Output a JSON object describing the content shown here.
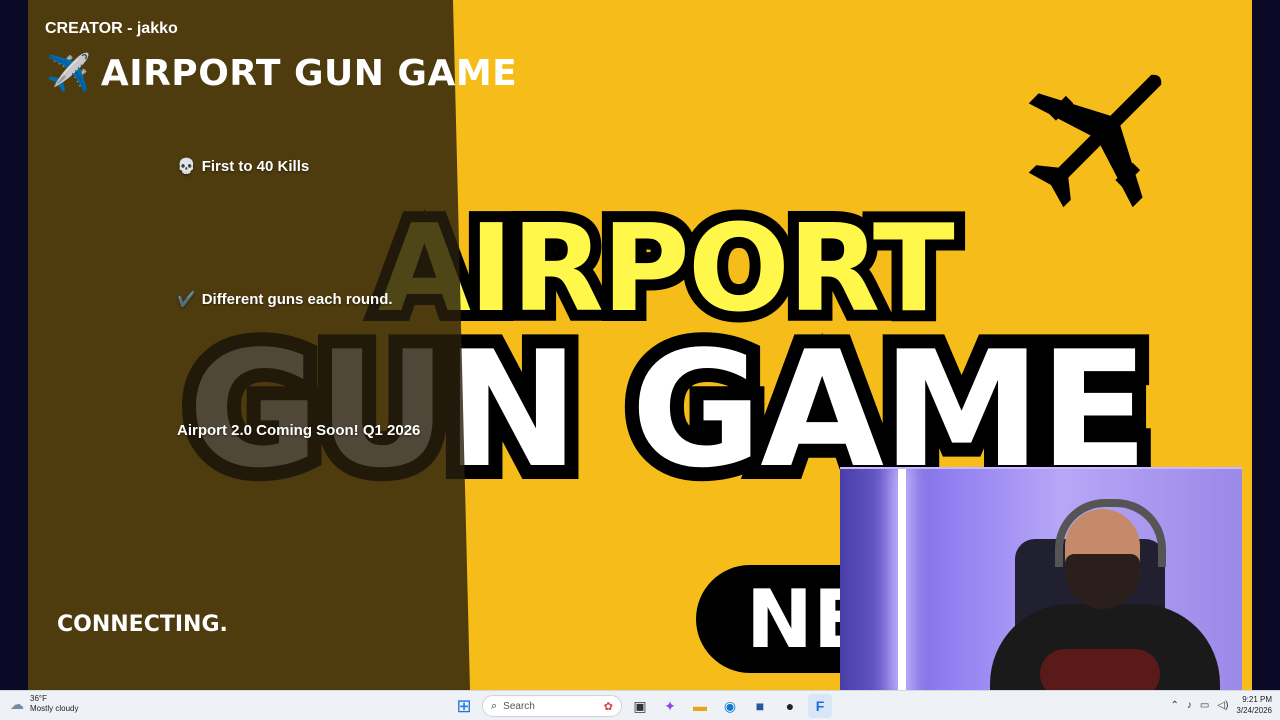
{
  "game": {
    "creator": "CREATOR - jakko",
    "title_emoji": "✈️",
    "title": "AIRPORT GUN GAME",
    "info": [
      {
        "icon": "💀",
        "text": "First to 40 Kills"
      },
      {
        "icon": "✔️",
        "text": "Different guns each round."
      },
      {
        "icon": "",
        "text": "Airport 2.0 Coming Soon! Q1 2026"
      }
    ],
    "status": "CONNECTING.",
    "banner": {
      "line1": "AIRPORT",
      "line2": "GUN GAME",
      "badge": "NE"
    },
    "colors": {
      "background": "#f6bd1a",
      "panel": "#28200c",
      "title_yellow": "#fff84a"
    }
  },
  "taskbar": {
    "weather": {
      "temp": "36°F",
      "condition": "Mostly cloudy",
      "icon": "cloud-icon"
    },
    "search_placeholder": "Search",
    "apps": [
      "start-icon",
      "search-box",
      "task-view-icon",
      "copilot-icon",
      "file-explorer-icon",
      "edge-icon",
      "store-icon",
      "obs-icon",
      "fortnite-icon"
    ],
    "clock": {
      "time": "9:21 PM",
      "date": "3/24/2026"
    }
  }
}
